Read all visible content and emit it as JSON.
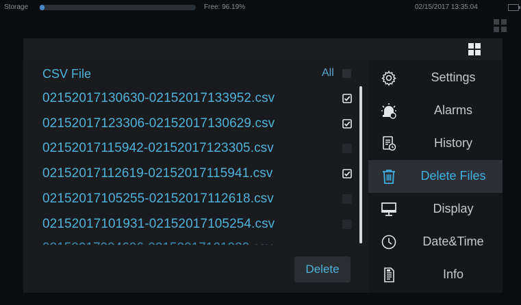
{
  "status_bar": {
    "storage_label": "Storage",
    "storage_fill_fraction": 0.03,
    "free_label": "Free: 96.19%",
    "datetime": "02/15/2017  13:35:04"
  },
  "file_list": {
    "header": "CSV File",
    "all_label": "All",
    "files": [
      {
        "name": "02152017130630-02152017133952.csv",
        "checked": true
      },
      {
        "name": "02152017123306-02152017130629.csv",
        "checked": true
      },
      {
        "name": "02152017115942-02152017123305.csv",
        "checked": false
      },
      {
        "name": "02152017112619-02152017115941.csv",
        "checked": true
      },
      {
        "name": "02152017105255-02152017112618.csv",
        "checked": false
      },
      {
        "name": "02152017101931-02152017105254.csv",
        "checked": false
      }
    ],
    "delete_label": "Delete"
  },
  "menu": {
    "items": [
      {
        "label": "Settings",
        "icon": "gear-icon"
      },
      {
        "label": "Alarms",
        "icon": "alarm-icon"
      },
      {
        "label": "History",
        "icon": "history-icon"
      },
      {
        "label": "Delete Files",
        "icon": "trash-icon",
        "active": true
      },
      {
        "label": "Display",
        "icon": "monitor-icon"
      },
      {
        "label": "Date&Time",
        "icon": "clock-icon"
      },
      {
        "label": "Info",
        "icon": "info-document-icon"
      }
    ]
  },
  "colors": {
    "accent": "#4fb3d9",
    "active_menu": "#3fb0e0",
    "background": "#0b0c0f"
  }
}
